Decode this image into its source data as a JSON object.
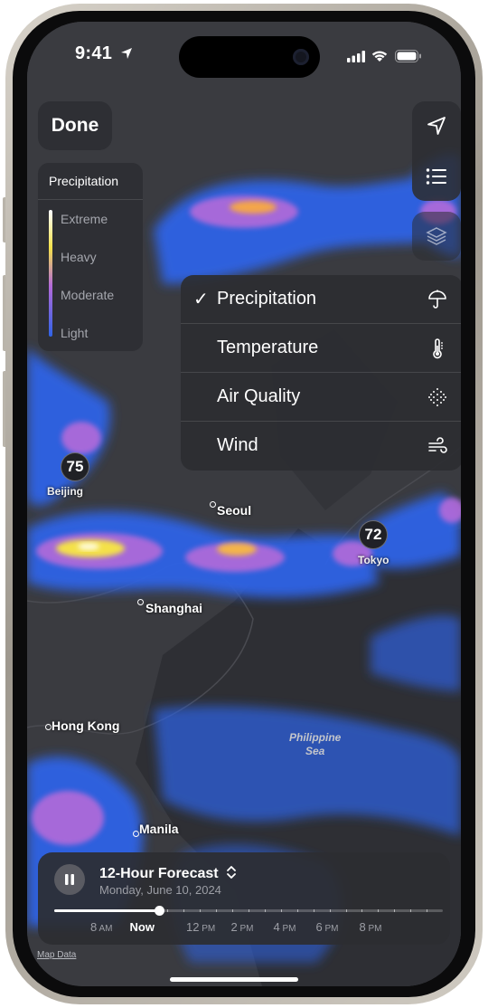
{
  "status_bar": {
    "time": "9:41"
  },
  "top_controls": {
    "done_label": "Done"
  },
  "legend": {
    "title": "Precipitation",
    "items": [
      "Extreme",
      "Heavy",
      "Moderate",
      "Light"
    ]
  },
  "layer_menu": {
    "items": [
      {
        "label": "Precipitation",
        "selected": true,
        "icon": "umbrella-icon"
      },
      {
        "label": "Temperature",
        "selected": false,
        "icon": "thermometer-icon"
      },
      {
        "label": "Air Quality",
        "selected": false,
        "icon": "air-quality-icon"
      },
      {
        "label": "Wind",
        "selected": false,
        "icon": "wind-icon"
      }
    ],
    "check_mark": "✓"
  },
  "map": {
    "cities": [
      {
        "name": "Beijing",
        "temperature": "75"
      },
      {
        "name": "Seoul"
      },
      {
        "name": "Tokyo",
        "temperature": "72"
      },
      {
        "name": "Shanghai"
      },
      {
        "name": "Hong Kong"
      },
      {
        "name": "Manila"
      }
    ],
    "sea_label_line1": "Philippine",
    "sea_label_line2": "Sea",
    "attribution": "Map Data"
  },
  "forecast": {
    "title": "12-Hour Forecast",
    "date": "Monday, June 10, 2024",
    "progress": 0.27,
    "time_labels": [
      {
        "num": "8",
        "ampm": "AM"
      },
      {
        "num": "Now",
        "ampm": ""
      },
      {
        "num": "12",
        "ampm": "PM"
      },
      {
        "num": "2",
        "ampm": "PM"
      },
      {
        "num": "4",
        "ampm": "PM"
      },
      {
        "num": "6",
        "ampm": "PM"
      },
      {
        "num": "8",
        "ampm": "PM"
      }
    ]
  },
  "colors": {
    "panel": "#2c2d32",
    "precip_light": "#2f63e6",
    "precip_moderate": "#b46ad9",
    "precip_heavy": "#f4e14a",
    "precip_extreme": "#ffffff",
    "land": "#3a3b40",
    "sea": "#2b2c31"
  }
}
